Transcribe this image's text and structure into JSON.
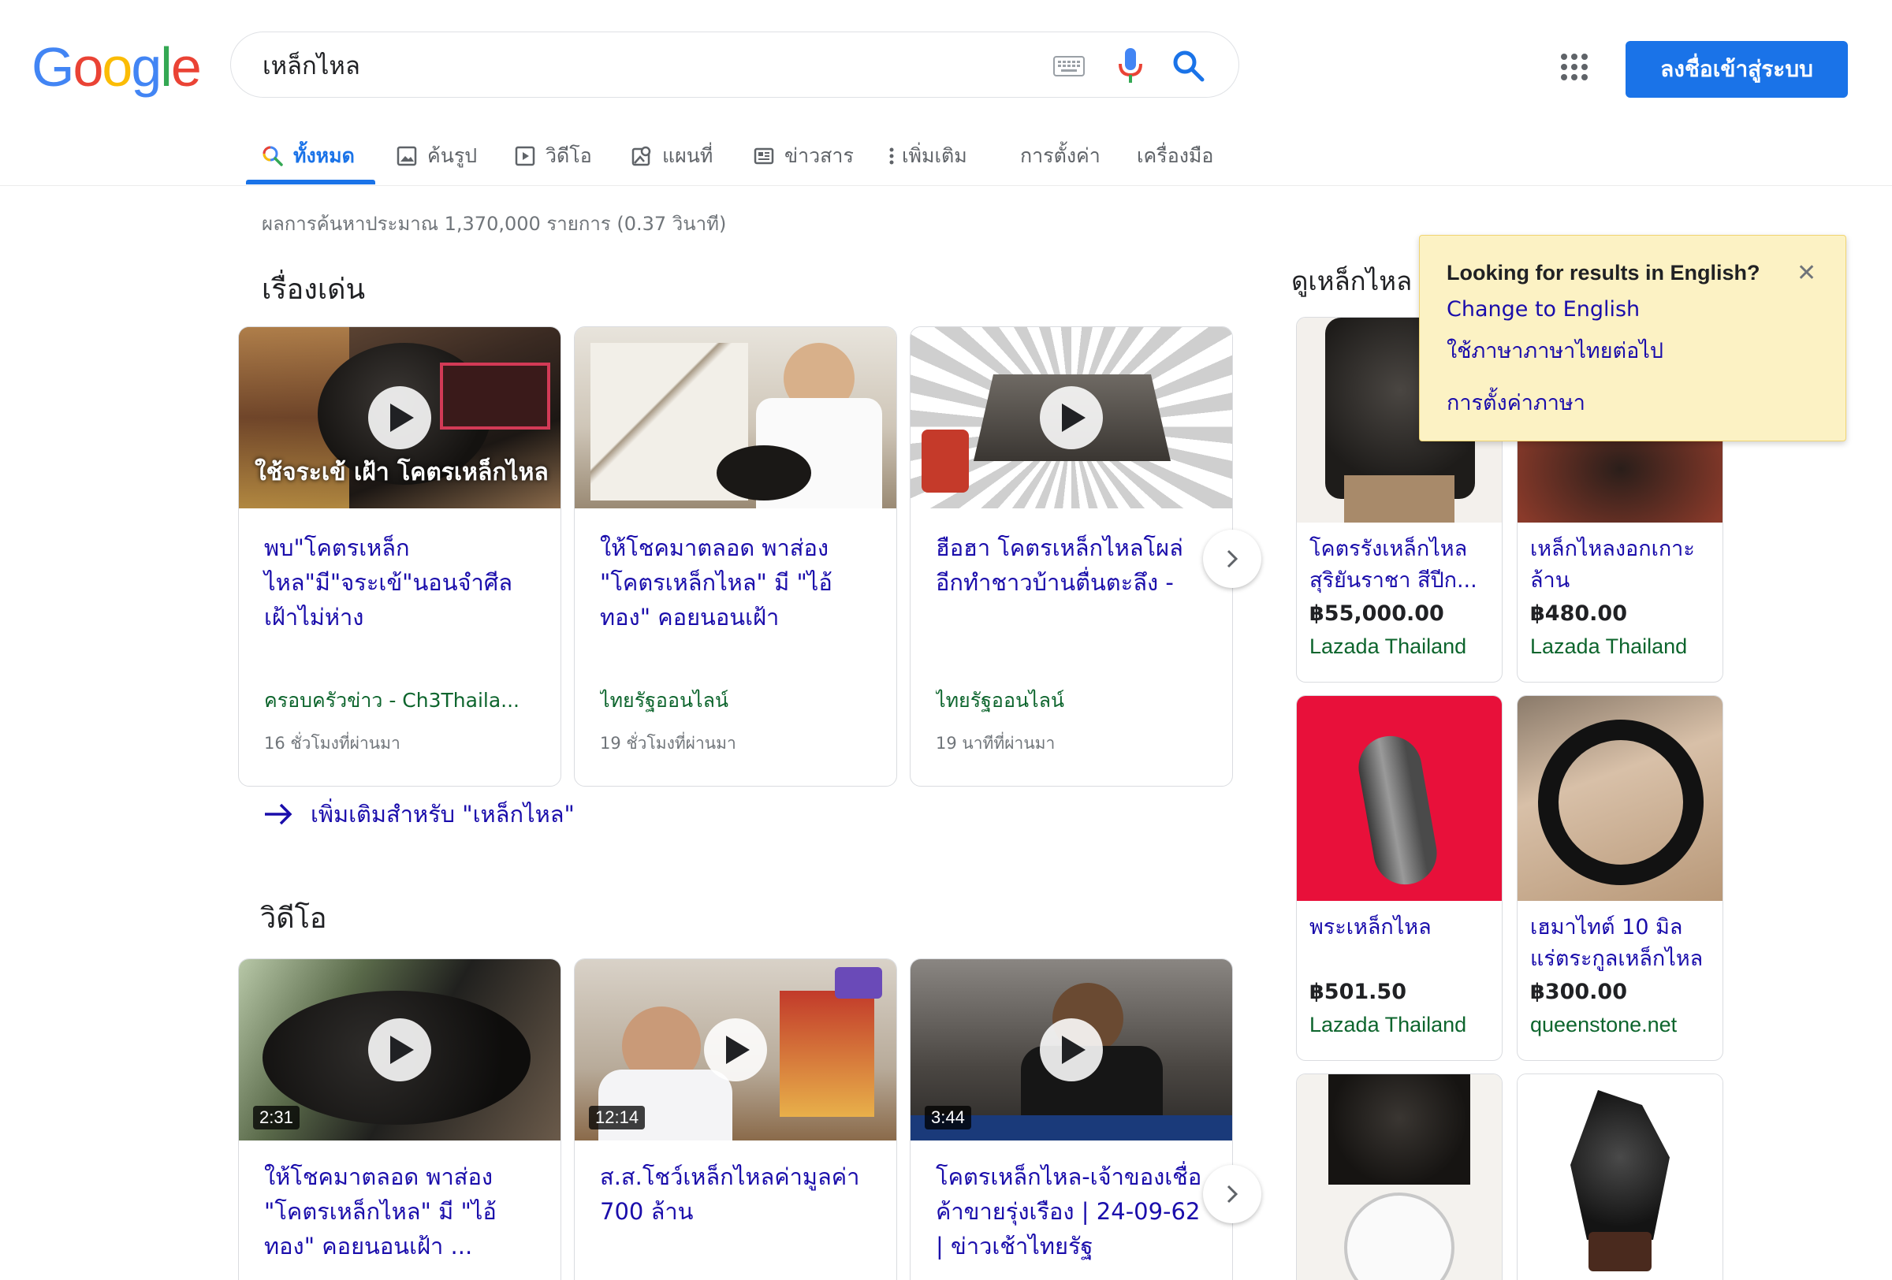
{
  "header": {
    "logo": [
      "G",
      "o",
      "o",
      "g",
      "l",
      "e"
    ],
    "logo_colors": [
      "#4285F4",
      "#EA4335",
      "#FBBC05",
      "#4285F4",
      "#34A853",
      "#EA4335"
    ],
    "search_value": "เหล็กไหล",
    "signin_label": "ลงชื่อเข้าสู่ระบบ"
  },
  "tabs": [
    {
      "label": "ทั้งหมด",
      "icon": "search-icon",
      "active": true
    },
    {
      "label": "ค้นรูป",
      "icon": "image-icon"
    },
    {
      "label": "วิดีโอ",
      "icon": "video-icon"
    },
    {
      "label": "แผนที่",
      "icon": "map-icon"
    },
    {
      "label": "ข่าวสาร",
      "icon": "news-icon"
    },
    {
      "label": "เพิ่มเติม",
      "icon": "more-vert-icon"
    },
    {
      "label": "การตั้งค่า"
    },
    {
      "label": "เครื่องมือ"
    }
  ],
  "result_stats": "ผลการค้นหาประมาณ 1,370,000 รายการ (0.37 วินาที)",
  "top_stories": {
    "title": "เรื่องเด่น",
    "cards": [
      {
        "title": "พบ\"โคตรเหล็กไหล\"มี\"จระเข้\"นอนจำศีลเฝ้าไม่ห่าง",
        "source": "ครอบครัวข่าว - Ch3Thaila...",
        "time": "16 ชั่วโมงที่ผ่านมา",
        "overlay": "ใช้จระเข้ เฝ้า โคตรเหล็กไหล",
        "has_play": true
      },
      {
        "title": "ให้โชคมาตลอด พาส่อง \"โคตรเหล็กไหล\" มี \"ไอ้ทอง\" คอยนอนเฝ้า",
        "source": "ไทยรัฐออนไลน์",
        "time": "19 ชั่วโมงที่ผ่านมา",
        "has_play": false
      },
      {
        "title": "ฮือฮา โคตรเหล็กไหลโผล่ อีกทำชาวบ้านตื่นตะลึง -",
        "source": "ไทยรัฐออนไลน์",
        "time": "19 นาทีที่ผ่านมา",
        "has_play": true
      }
    ],
    "more_link": "เพิ่มเติมสำหรับ \"เหล็กไหล\""
  },
  "videos": {
    "title": "วิดีโอ",
    "cards": [
      {
        "title": "ให้โชคมาตลอด พาส่อง \"โคตรเหล็กไหล\" มี \"ไอ้ทอง\" คอยนอนเฝ้า ...",
        "duration": "2:31"
      },
      {
        "title": "ส.ส.โชว์เหล็กไหลค่ามูลค่า 700 ล้าน",
        "duration": "12:14"
      },
      {
        "title": "โคตรเหล็กไหล-เจ้าของเชื่อ ค้าขายรุ่งเรือง | 24-09-62 | ข่าวเช้าไทยรัฐ",
        "duration": "3:44"
      }
    ]
  },
  "shopping": {
    "title": "ดูเหล็กไหล",
    "items": [
      {
        "title": "โคตรรังเหล็กไหล สุริยันราชา สีปีก...",
        "price": "฿55,000.00",
        "store": "Lazada Thailand"
      },
      {
        "title": "เหล็กไหลงอกเกาะล้าน",
        "price": "฿480.00",
        "store": "Lazada Thailand"
      },
      {
        "title": "พระเหล็กไหล",
        "price": "฿501.50",
        "store": "Lazada Thailand"
      },
      {
        "title": "เฮมาไทต์ 10 มิล แร่ตระกูลเหล็กไหล",
        "price": "฿300.00",
        "store": "queenstone.net"
      }
    ]
  },
  "lang_popup": {
    "title": "Looking for results in English?",
    "close": "✕",
    "change_english": "Change to English",
    "keep_thai": "ใช้ภาษาภาษาไทยต่อไป",
    "lang_settings": "การตั้งค่าภาษา"
  }
}
